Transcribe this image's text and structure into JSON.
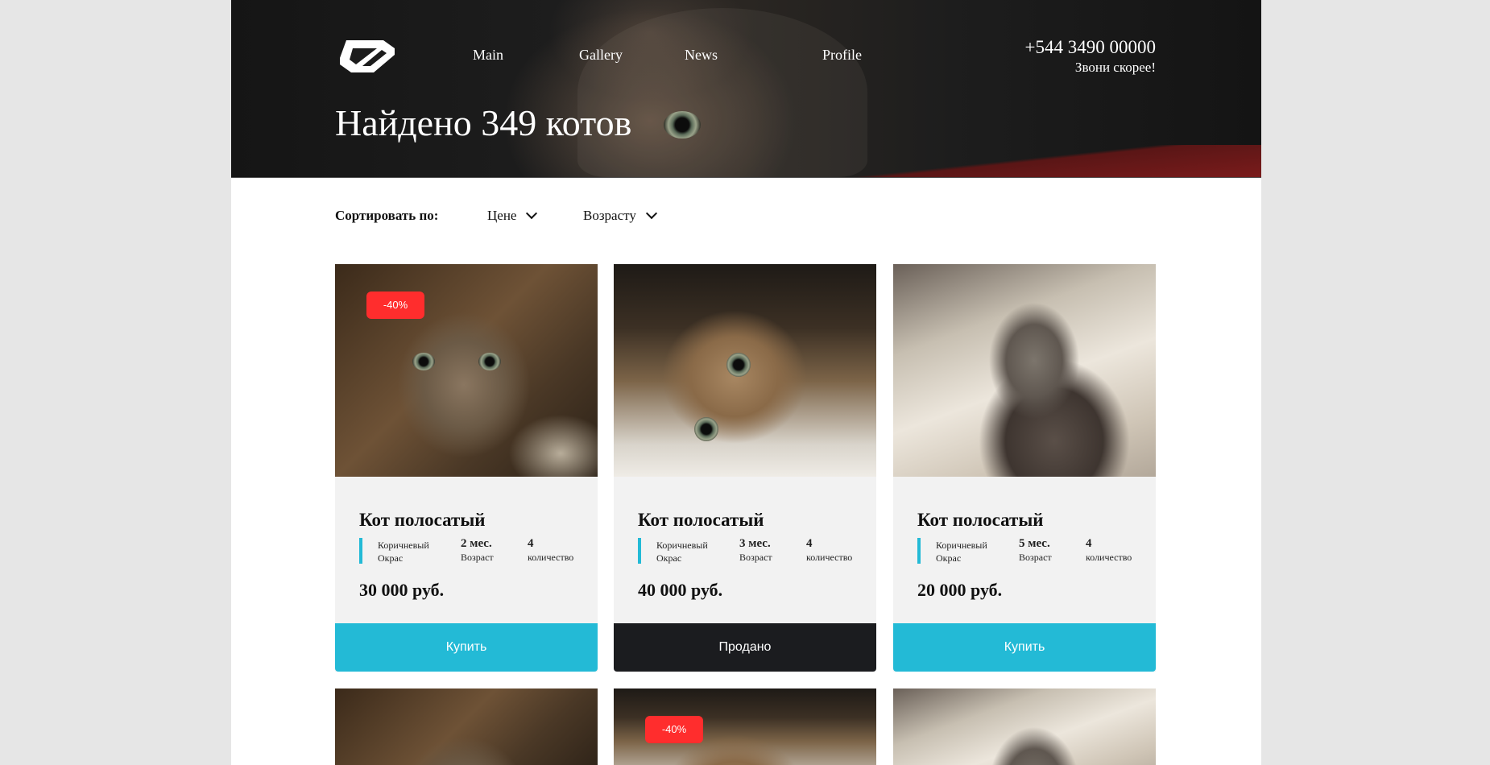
{
  "header": {
    "nav": [
      "Main",
      "Gallery",
      "News",
      "Profile"
    ],
    "phone": "+544 3490 00000",
    "phone_note": "Звони скорее!",
    "title": "Найдено 349 котов"
  },
  "sort": {
    "label": "Сортировать по:",
    "options": [
      "Цене",
      "Возрасту"
    ]
  },
  "cards": [
    {
      "badge": "-40%",
      "title": "Кот полосатый",
      "color_value": "Коричневый",
      "color_label": "Окрас",
      "age_value": "2 мес.",
      "age_label": "Возраст",
      "count_value": "4",
      "count_label": "количество",
      "price": "30 000 руб.",
      "button": "Купить",
      "button_color": "#23bad6"
    },
    {
      "badge": "",
      "title": "Кот полосатый",
      "color_value": "Коричневый",
      "color_label": "Окрас",
      "age_value": "3 мес.",
      "age_label": "Возраст",
      "count_value": "4",
      "count_label": "количество",
      "price": "40 000 руб.",
      "button": "Продано",
      "button_color": "#1b1c1f"
    },
    {
      "badge": "",
      "title": "Кот полосатый",
      "color_value": "Коричневый",
      "color_label": "Окрас",
      "age_value": "5 мес.",
      "age_label": "Возраст",
      "count_value": "4",
      "count_label": "количество",
      "price": "20 000 руб.",
      "button": "Купить",
      "button_color": "#23bad6"
    }
  ],
  "second_row": {
    "badge": "-40%"
  },
  "colors": {
    "accent": "#23bad6",
    "sold": "#1b1c1f",
    "badge": "#ff2d2d"
  }
}
